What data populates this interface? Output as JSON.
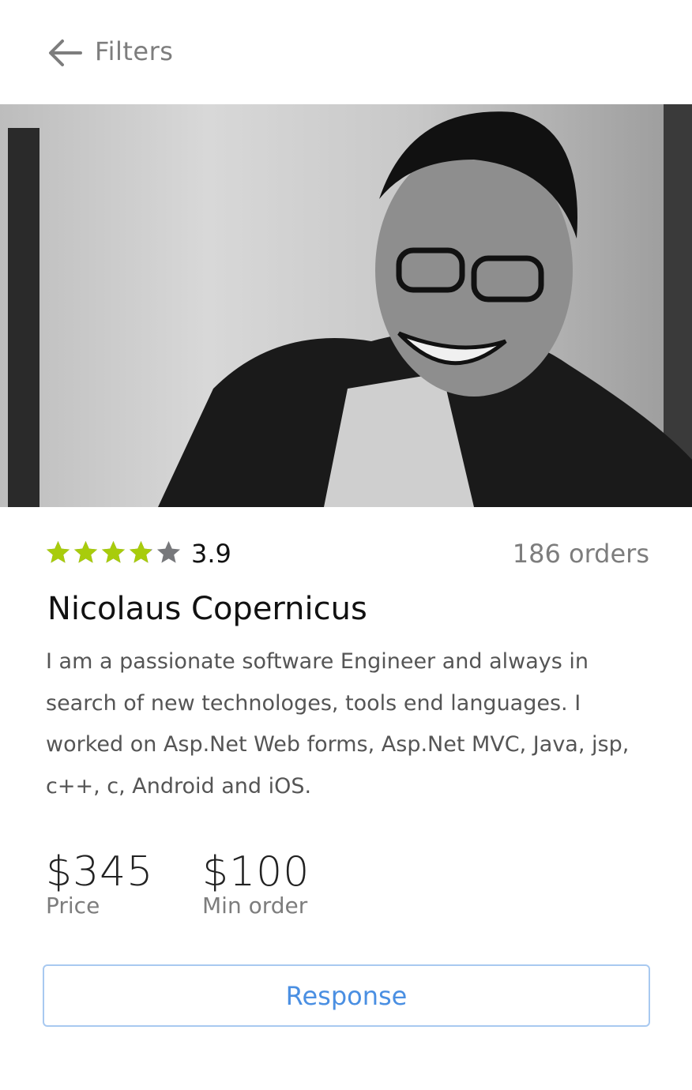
{
  "header": {
    "title": "Filters",
    "back_icon": "arrow-left-icon"
  },
  "profile": {
    "photo_alt": "profile-photo",
    "rating": "3.9",
    "rating_value": 3.9,
    "rating_max": 5,
    "orders": "186 orders",
    "name": "Nicolaus Copernicus",
    "bio": "I am a passionate software Engineer and always in search of new technologes, tools end languages. I worked on Asp.Net Web forms, Asp.Net MVC, Java, jsp, c++, c, Android and iOS."
  },
  "pricing": {
    "price": "$345",
    "price_label": "Price",
    "min_order": "$100",
    "min_order_label": "Min order"
  },
  "actions": {
    "response_label": "Response"
  },
  "colors": {
    "star_filled": "#a8cc0c",
    "star_empty": "#77787b",
    "accent": "#4a8fe2"
  }
}
